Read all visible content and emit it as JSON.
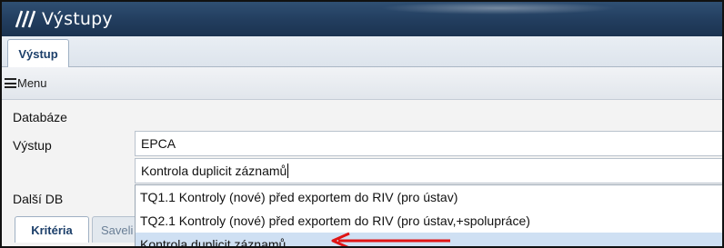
{
  "window": {
    "title": "Výstupy",
    "logo_icon": "triple-slash-logo",
    "titlebar_color": "#223d5e"
  },
  "tabs": [
    {
      "label": "Výstup",
      "active": true
    }
  ],
  "menubar": {
    "menu_label": "Menu",
    "menu_icon": "hamburger-icon"
  },
  "form": {
    "databaze": {
      "label": "Databáze",
      "value": "EPCA"
    },
    "vystup": {
      "label": "Výstup",
      "value": "Kontrola duplicit záznamů"
    },
    "dalsi_db": {
      "label": "Další DB"
    }
  },
  "dropdown": {
    "options": [
      "TQ1.1 Kontroly (nové) před exportem do RIV (pro ústav)",
      "TQ2.1 Kontroly (nové) před exportem do RIV (pro ústav,+spolupráce)",
      "Kontrola duplicit záznamů"
    ],
    "selected_index": 2,
    "highlight_color": "#cfe0f3"
  },
  "lower_tabs": [
    {
      "label": "Kritéria",
      "active": true
    },
    {
      "label": "Saveli",
      "active": false
    }
  ],
  "annotation": {
    "type": "red-arrow",
    "color": "#e01515",
    "points_to": "Kontrola duplicit záznamů"
  }
}
